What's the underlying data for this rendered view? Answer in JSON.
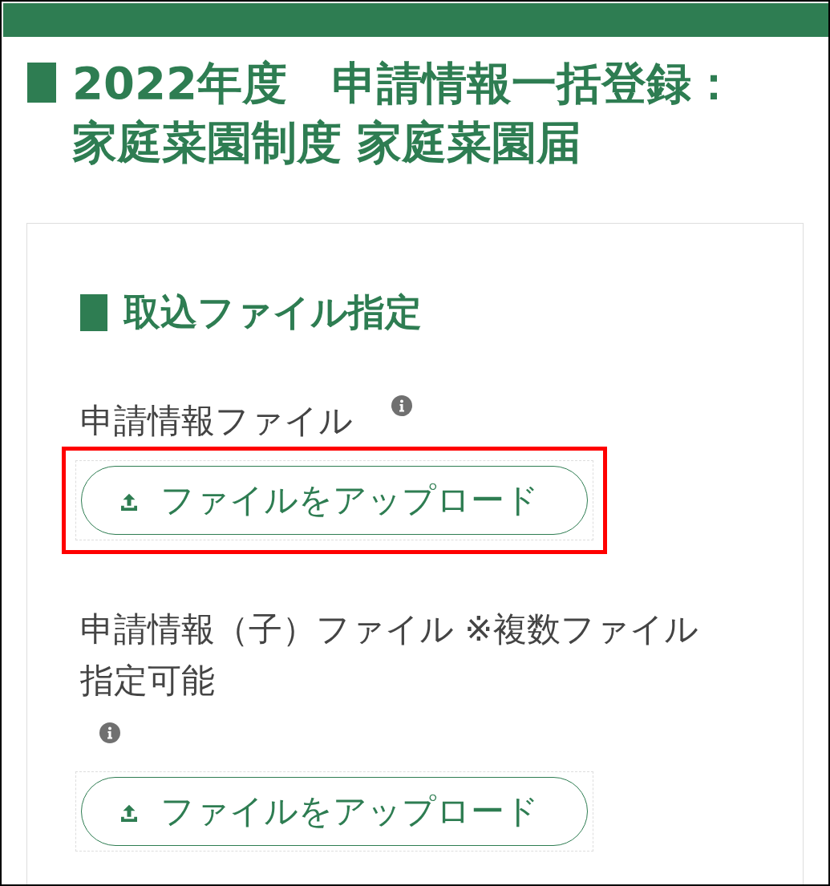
{
  "page_title": [
    "2022年度　申請情報一括登録：",
    "家庭菜園制度 家庭菜園届"
  ],
  "section": {
    "heading": "取込ファイル指定",
    "fields": [
      {
        "label": "申請情報ファイル",
        "info": true,
        "button": "ファイルをアップロード",
        "highlighted": true
      },
      {
        "label": "申請情報（子）ファイル ※複数ファイル指定可能",
        "info": true,
        "button": "ファイルをアップロード",
        "highlighted": false
      }
    ]
  }
}
